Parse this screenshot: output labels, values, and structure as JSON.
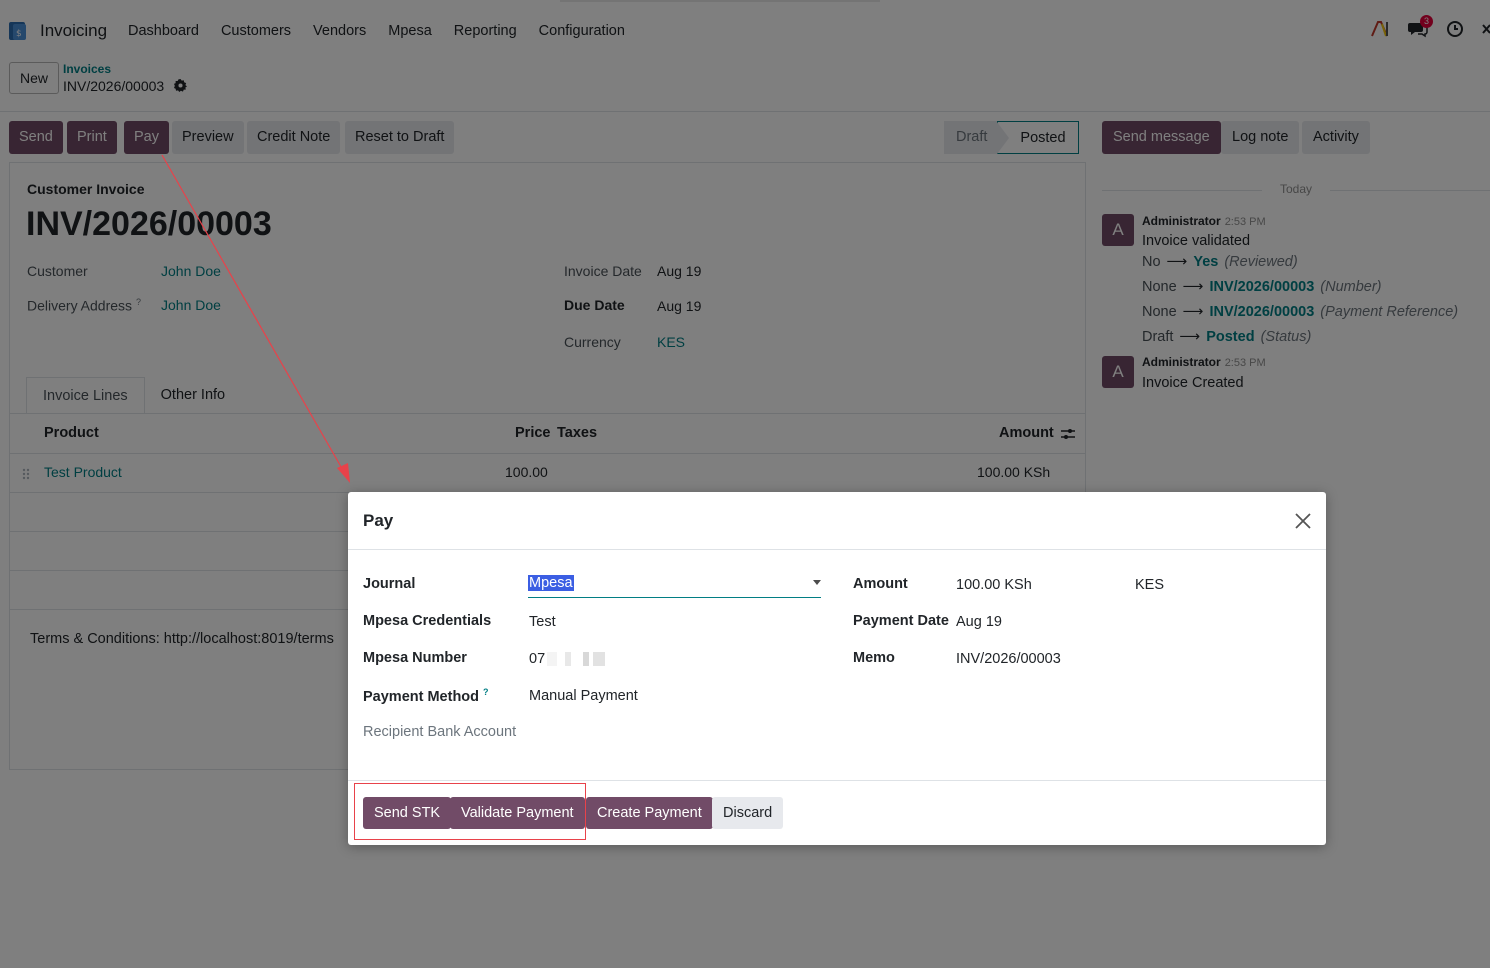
{
  "navbar": {
    "app_name": "Invoicing",
    "menu": [
      "Dashboard",
      "Customers",
      "Vendors",
      "Mpesa",
      "Reporting",
      "Configuration"
    ],
    "messages_badge": "3"
  },
  "control": {
    "new_label": "New",
    "breadcrumb_parent": "Invoices",
    "breadcrumb_current": "INV/2026/00003"
  },
  "actions": {
    "send": "Send",
    "print": "Print",
    "pay": "Pay",
    "preview": "Preview",
    "credit_note": "Credit Note",
    "reset_to_draft": "Reset to Draft"
  },
  "status": {
    "draft": "Draft",
    "posted": "Posted",
    "current": "Posted"
  },
  "invoice": {
    "type": "Customer Invoice",
    "number": "INV/2026/00003",
    "customer_label": "Customer",
    "customer": "John Doe",
    "delivery_label": "Delivery Address",
    "delivery_hint": "?",
    "delivery": "John Doe",
    "invoice_date_label": "Invoice Date",
    "invoice_date": "Aug 19",
    "due_date_label": "Due Date",
    "due_date": "Aug 19",
    "currency_label": "Currency",
    "currency": "KES",
    "tabs": [
      "Invoice Lines",
      "Other Info"
    ],
    "columns": {
      "product": "Product",
      "price": "Price",
      "taxes": "Taxes",
      "amount": "Amount"
    },
    "lines": [
      {
        "product": "Test Product",
        "price": "100.00",
        "amount": "100.00 KSh"
      }
    ],
    "terms": "Terms & Conditions: http://localhost:8019/terms"
  },
  "chatter": {
    "send_message": "Send message",
    "log_note": "Log note",
    "activity": "Activity",
    "today": "Today",
    "messages": [
      {
        "avatar": "A",
        "author": "Administrator",
        "time": "2:53 PM",
        "body": "Invoice validated",
        "tracking": [
          {
            "old": "No",
            "new": "Yes",
            "field": "(Reviewed)"
          },
          {
            "old": "None",
            "new": "INV/2026/00003",
            "field": "(Number)"
          },
          {
            "old": "None",
            "new": "INV/2026/00003",
            "field": "(Payment Reference)"
          },
          {
            "old": "Draft",
            "new": "Posted",
            "field": "(Status)"
          }
        ]
      },
      {
        "avatar": "A",
        "author": "Administrator",
        "time": "2:53 PM",
        "body": "Invoice Created"
      }
    ]
  },
  "dialog": {
    "title": "Pay",
    "journal_label": "Journal",
    "journal": "Mpesa",
    "credentials_label": "Mpesa Credentials",
    "credentials": "Test",
    "mpesa_number_label": "Mpesa Number",
    "mpesa_number_prefix": "07",
    "payment_method_label": "Payment Method",
    "payment_method_hint": "?",
    "payment_method": "Manual Payment",
    "recipient_label": "Recipient Bank Account",
    "amount_label": "Amount",
    "amount": "100.00 KSh",
    "amount_currency": "KES",
    "payment_date_label": "Payment Date",
    "payment_date": "Aug 19",
    "memo_label": "Memo",
    "memo": "INV/2026/00003",
    "buttons": {
      "send_stk": "Send STK",
      "validate_payment": "Validate Payment",
      "create_payment": "Create Payment",
      "discard": "Discard"
    }
  },
  "colors": {
    "primary": "#714b67",
    "link": "#017e84",
    "annotation": "#e8424a",
    "badge": "#e4003a"
  }
}
